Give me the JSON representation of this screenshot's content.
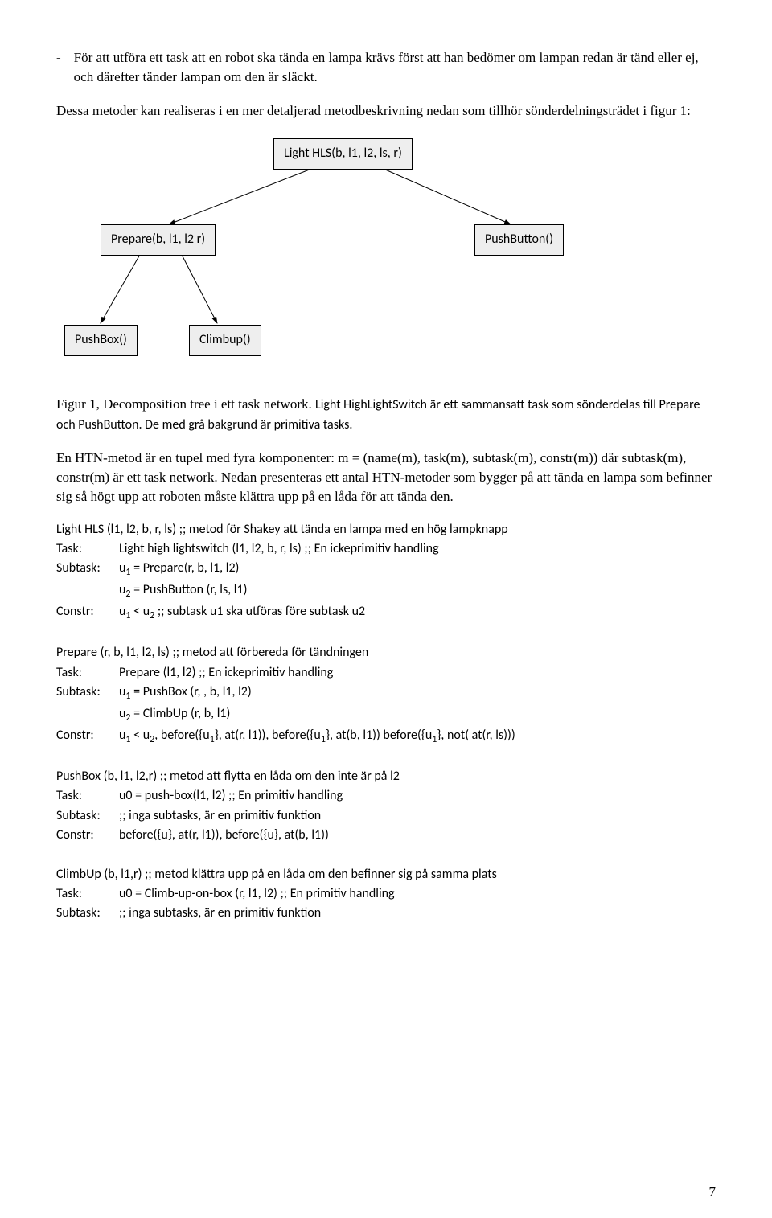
{
  "bulletPara": "För att utföra ett task att en robot ska tända en lampa krävs först att han bedömer om lampan redan är tänd eller ej, och därefter tänder lampan om den är släckt.",
  "introPara": "Dessa metoder kan realiseras i en mer detaljerad metodbeskrivning nedan som tillhör sönderdelningsträdet i figur 1:",
  "diagram": {
    "root": "Light HLS(b, l1, l2, ls, r)",
    "mid1": "Prepare(b, l1, l2 r)",
    "mid2": "PushButton()",
    "leaf1": "PushBox()",
    "leaf2": "Climbup()"
  },
  "figCaption": {
    "prefix": "Figur 1, Decomposition tree i ett task network. ",
    "mid": "Light HighLightSwitch är ett sammansatt task som sönderdelas till Prepare och PushButton. De med grå bakgrund är primitiva tasks."
  },
  "htnPara": "En HTN-metod är en tupel med fyra komponenter: m = (name(m), task(m), subtask(m), constr(m)) där subtask(m), constr(m) är ett task network. Nedan presenteras ett antal HTN-metoder som bygger på att tända en lampa som befinner sig så högt upp att roboten måste klättra upp på en låda för att tända den.",
  "m1": {
    "title": "Light HLS (l1, l2, b, r, ls) ;; metod för Shakey att tända en lampa med en hög lampknapp",
    "task": "Light high lightswitch (l1, l2, b, r, ls) ;; En ickeprimitiv handling",
    "sub1a": "u",
    "sub1b": " = Prepare(r, b, l1, l2)",
    "sub2a": "u",
    "sub2b": " = PushButton (r, ls, l1)",
    "constrA": "u",
    "constrB": " < u",
    "constrC": "  ;; subtask u1 ska utföras före subtask u2"
  },
  "m2": {
    "title": "Prepare (r, b, l1, l2, ls) ;; metod att förbereda för tändningen",
    "task": "Prepare (l1, l2) ;; En ickeprimitiv handling",
    "sub1a": "u",
    "sub1b": " = PushBox (r, , b, l1, l2)",
    "sub2a": "u",
    "sub2b": " = ClimbUp (r, b, l1)",
    "constrA": "u",
    "constrB": " < u",
    "constrC": ", before({u",
    "constrD": "}, at(r, l1)), before({u",
    "constrE": "}, at(b, l1)) before({u",
    "constrF": "},  not( at(r, ls)))"
  },
  "m3": {
    "title": "PushBox (b, l1, l2,r) ;; metod att flytta en låda om den inte är på l2",
    "task": "u0 = push-box(l1, l2) ;; En primitiv handling",
    "sub": ";; inga subtasks, är en primitiv funktion",
    "constr": "before({u}, at(r, l1)), before({u}, at(b, l1))"
  },
  "m4": {
    "title": "ClimbUp (b, l1,r) ;; metod klättra upp på en låda om den befinner sig på samma plats",
    "task": "u0 = Climb-up-on-box (r, l1, l2) ;; En primitiv handling",
    "sub": ";; inga subtasks, är en primitiv funktion"
  },
  "labels": {
    "task": "Task:",
    "subtask": "Subtask:",
    "constr": "Constr:"
  },
  "pageNo": "7"
}
